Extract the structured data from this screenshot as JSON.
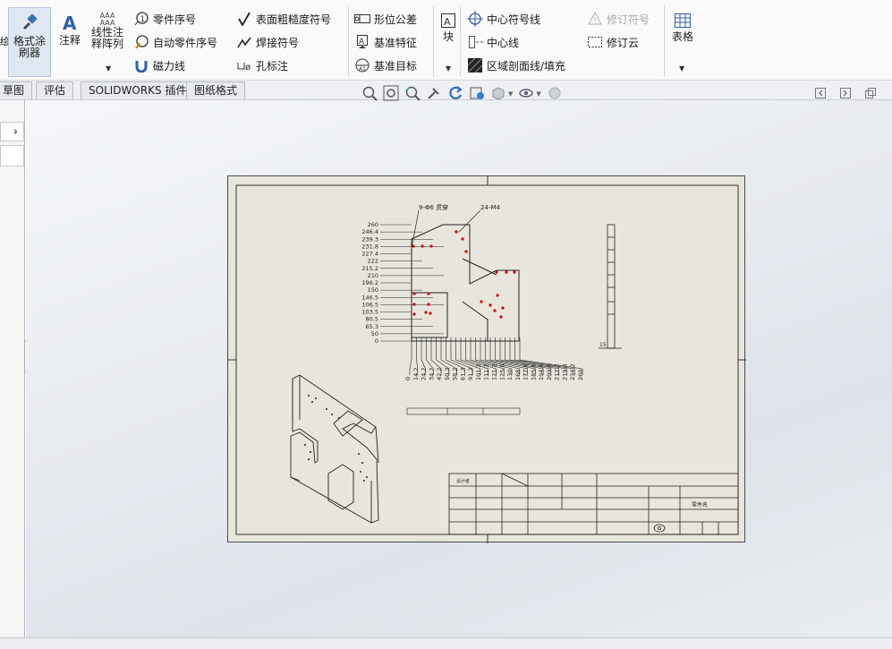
{
  "ribbon": {
    "format_painter": "格式涂\n刷器",
    "note": "注释",
    "linear_pattern": "线性注\n释阵列",
    "balloon": "零件序号",
    "auto_balloon": "自动零件序号",
    "magnetic_line": "磁力线",
    "surface_finish": "表面粗糙度符号",
    "weld_symbol": "焊接符号",
    "hole_callout": "孔标注",
    "geometric_tolerance": "形位公差",
    "datum_feature": "基准特征",
    "datum_target": "基准目标",
    "block": "块",
    "center_mark": "中心符号线",
    "centerline": "中心线",
    "area_hatch": "区域剖面线/填充",
    "revision_symbol": "修订符号",
    "revision_cloud": "修订云",
    "table": "表格"
  },
  "tabs": [
    "草图",
    "评估",
    "SOLIDWORKS 插件",
    "图纸格式"
  ],
  "drawing": {
    "ordinate_y": [
      "260",
      "246.4",
      "239.3",
      "231.8",
      "227.4",
      "222",
      "215.2",
      "210",
      "196.2",
      "150",
      "146.5",
      "106.5",
      "103.5",
      "80.5",
      "65.3",
      "50",
      "0"
    ],
    "ordinate_x": [
      "0",
      "14.2",
      "24.2",
      "34.2",
      "42.2",
      "50.2",
      "58.2",
      "61.2",
      "91.2",
      "101.2",
      "111.2",
      "121.2",
      "125.8",
      "130",
      "168",
      "177.8",
      "185.6",
      "194.6",
      "209.6",
      "217.2",
      "219.4",
      "234.2",
      "260"
    ],
    "note_holes_left": "9-Φ6 贯穿",
    "note_holes_right": "24-M4",
    "side_dim": "15",
    "title_block": {
      "designer": "设计者",
      "part_name": "零件名"
    }
  }
}
